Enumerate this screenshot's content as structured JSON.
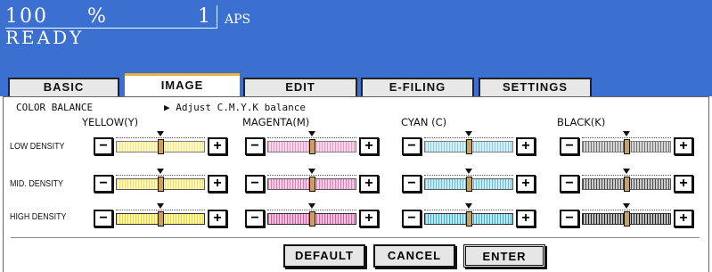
{
  "status": {
    "copies": "100",
    "percent": "%",
    "count": "1",
    "paper": "APS",
    "message": "READY"
  },
  "tabs": [
    {
      "label": "BASIC",
      "active": false
    },
    {
      "label": "IMAGE",
      "active": true
    },
    {
      "label": "EDIT",
      "active": false
    },
    {
      "label": "E-FILING",
      "active": false
    },
    {
      "label": "SETTINGS",
      "active": false
    }
  ],
  "panel": {
    "title": "COLOR BALANCE",
    "hint": "▶ Adjust C.M.Y.K balance"
  },
  "columns": [
    {
      "label": "YELLOW(Y)",
      "color": "#f2d21e",
      "light": "#fff6b0"
    },
    {
      "label": "MAGENTA(M)",
      "color": "#e8479a",
      "light": "#f9c3de"
    },
    {
      "label": "CYAN (C)",
      "color": "#2aa9e0",
      "light": "#bfe6f6"
    },
    {
      "label": "BLACK(K)",
      "color": "#111111",
      "light": "#bbbbbb"
    }
  ],
  "rows": [
    {
      "label": "LOW DENSITY"
    },
    {
      "label": "MID. DENSITY"
    },
    {
      "label": "HIGH DENSITY"
    }
  ],
  "levels": [
    [
      0.5,
      0.5,
      0.5,
      0.5
    ],
    [
      0.5,
      0.5,
      0.5,
      0.5
    ],
    [
      0.5,
      0.5,
      0.5,
      0.5
    ]
  ],
  "buttons": {
    "minus": "−",
    "plus": "+"
  },
  "actions": {
    "default": "DEFAULT",
    "cancel": "CANCEL",
    "enter": "ENTER"
  }
}
